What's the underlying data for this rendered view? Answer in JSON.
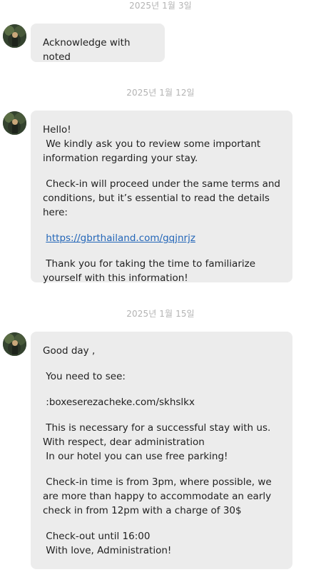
{
  "dates": [
    "2025년 1월 3일",
    "2025년 1월 12일",
    "2025년 1월 15일"
  ],
  "messages": [
    {
      "paragraphs": [
        "Acknowledge with noted"
      ]
    },
    {
      "p1": "Hello!\n We kindly ask you to review some important information regarding your stay.",
      "p2": " Check-in will proceed under the same terms and conditions, but it’s essential to read the details here:",
      "link": "https://gbrthailand.com/gqjnrjz",
      "p4": " Thank you for taking the time to familiarize yourself with this information!"
    },
    {
      "p1": "Good day ,",
      "p2": " You need to see:",
      "p3": " :boxeserezacheke.com/skhslkx",
      "p4": " This is necessary for a successful stay with us. With respect, dear administration\n In our hotel you can use free parking!",
      "p5": " Check-in time is from 3pm, where possible, we are more than happy to accommodate an early check in from 12pm with a charge of 30$",
      "p6": " Check-out until 16:00\n With love, Administration!"
    }
  ],
  "colors": {
    "bubble": "#ececec",
    "link": "#2366b8",
    "date": "#b3b3b3"
  },
  "avatar_icon": "user-avatar-photo"
}
